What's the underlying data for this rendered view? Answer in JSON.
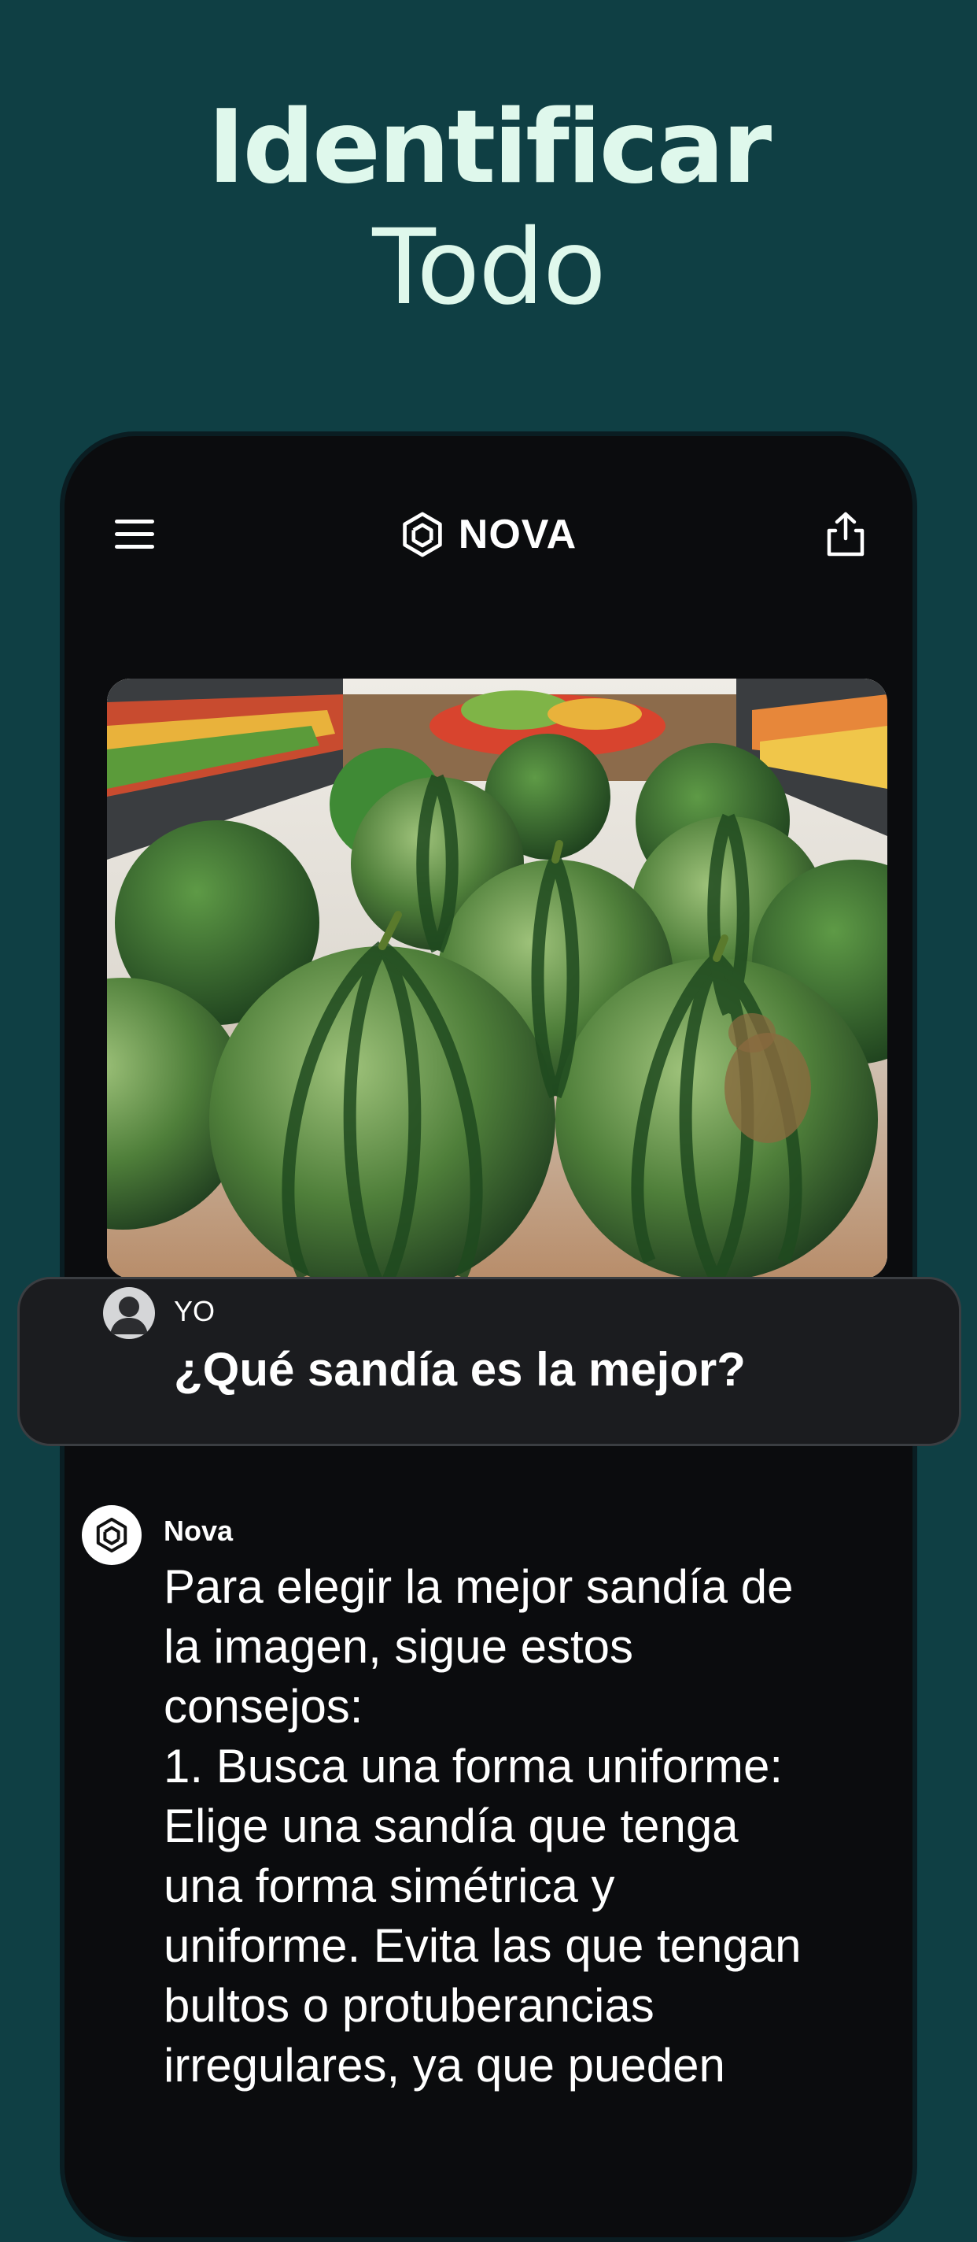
{
  "hero": {
    "title_line1": "Identificar",
    "title_line2": "Todo"
  },
  "app": {
    "name": "NOVA",
    "icons": {
      "menu": "hamburger-menu-icon",
      "logo": "nova-logo-icon",
      "share": "share-icon"
    }
  },
  "photo": {
    "subject": "watermelons"
  },
  "user_message": {
    "author": "YO",
    "text": "¿Qué sandía es la mejor?"
  },
  "assistant_message": {
    "author": "Nova",
    "lines": [
      "Para elegir la mejor sandía de",
      "la imagen, sigue estos",
      "consejos:",
      "1. Busca una forma uniforme:",
      "Elige una sandía que tenga",
      "una forma simétrica y",
      "uniforme. Evita las que tengan",
      "bultos o protuberancias",
      "irregulares, ya que pueden"
    ]
  },
  "colors": {
    "background": "#0f3f44",
    "hero_text": "#dff8ec",
    "phone": "#0b0c0e",
    "bubble": "#1b1c1f"
  }
}
